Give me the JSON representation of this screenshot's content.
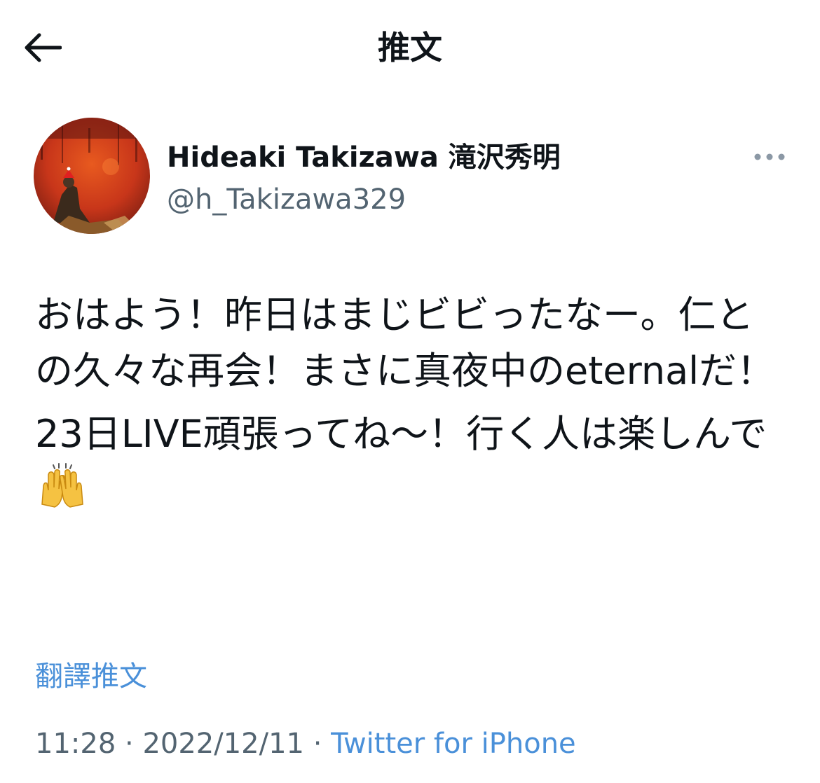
{
  "header": {
    "title": "推文",
    "back_icon": "arrow-left-icon"
  },
  "author": {
    "display_name": "Hideaki Takizawa 滝沢秀明",
    "handle": "@h_Takizawa329",
    "more_icon": "more-dots-icon"
  },
  "tweet": {
    "paragraph_1": "おはよう！昨日はまじビビったなー。仁との久々な再会！まさに真夜中のeternalだ！",
    "paragraph_2": "23日LIVE頑張ってね〜！行く人は楽しんで",
    "emoji": "raising-hands-icon"
  },
  "translate": {
    "label": "翻譯推文"
  },
  "meta": {
    "time": "11:28",
    "date": "2022/12/11",
    "separator": "·",
    "source": "Twitter for iPhone"
  },
  "colors": {
    "link": "#4a90d9",
    "secondary_text": "#536471",
    "primary_text": "#0f1419"
  }
}
